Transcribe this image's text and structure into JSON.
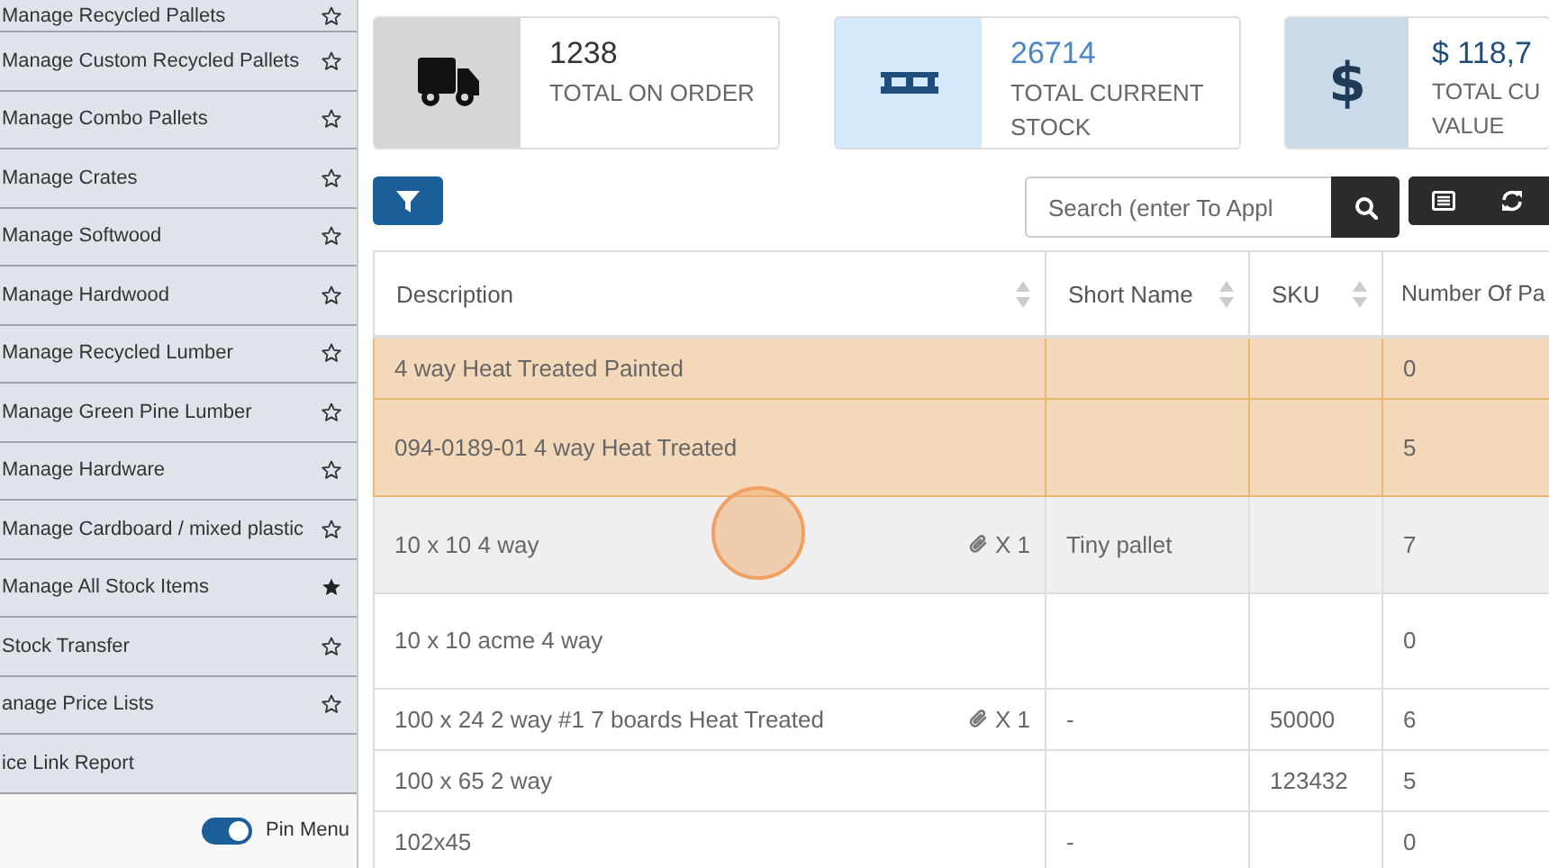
{
  "sidebar": {
    "items": [
      {
        "kind": "favorite",
        "label": "Manage Recycled Pallets",
        "starred": false
      },
      {
        "kind": "favorite",
        "label": "Manage Custom Recycled Pallets",
        "starred": false
      },
      {
        "kind": "favorite",
        "label": "Manage Combo Pallets",
        "starred": false
      },
      {
        "kind": "favorite",
        "label": "Manage Crates",
        "starred": false
      },
      {
        "kind": "favorite",
        "label": "Manage Softwood",
        "starred": false
      },
      {
        "kind": "favorite",
        "label": "Manage Hardwood",
        "starred": false
      },
      {
        "kind": "favorite",
        "label": "Manage Recycled Lumber",
        "starred": false
      },
      {
        "kind": "favorite",
        "label": "Manage Green Pine Lumber",
        "starred": false
      },
      {
        "kind": "favorite",
        "label": "Manage Hardware",
        "starred": false
      },
      {
        "kind": "favorite",
        "label": "Manage Cardboard / mixed plastic",
        "starred": false
      },
      {
        "kind": "favorite",
        "label": "Manage All Stock Items",
        "starred": true
      },
      {
        "kind": "favorite",
        "label": "Stock Transfer",
        "starred": false
      },
      {
        "kind": "favorite",
        "label": "anage Price Lists",
        "starred": false
      },
      {
        "kind": "plain",
        "label": "ice Link Report"
      }
    ],
    "pin_menu": {
      "label": "Pin Menu",
      "on": true
    }
  },
  "stats": [
    {
      "kind": "truck",
      "value": "1238",
      "label": "TOTAL ON ORDER"
    },
    {
      "kind": "pallet",
      "value": "26714",
      "label": "TOTAL CURRENT STOCK"
    },
    {
      "kind": "dollar",
      "icon_text": "$",
      "value": "$ 118,7",
      "label": "TOTAL CU VALUE"
    }
  ],
  "toolbar": {
    "search": {
      "placeholder": "Search (enter To Appl"
    }
  },
  "table": {
    "columns": [
      {
        "label": "Description",
        "sortable": true
      },
      {
        "label": "Short Name",
        "sortable": true
      },
      {
        "label": "SKU",
        "sortable": true
      },
      {
        "label": "Number Of Pa"
      }
    ],
    "rows": [
      {
        "highlighted": true,
        "hovered": false,
        "description": "4 way Heat Treated Painted",
        "number": "0"
      },
      {
        "highlighted": true,
        "hovered": false,
        "description": "094-0189-01 4 way Heat Treated",
        "number": "5"
      },
      {
        "highlighted": false,
        "hovered": true,
        "description": "10 x 10 4 way",
        "attachment": "X 1",
        "short_name": "Tiny pallet",
        "number": "7"
      },
      {
        "highlighted": false,
        "hovered": false,
        "description": "10 x 10 acme 4 way",
        "number": "0"
      },
      {
        "highlighted": false,
        "hovered": false,
        "description": "100 x 24 2 way #1 7 boards Heat Treated",
        "attachment": "X 1",
        "short_name": "-",
        "sku": "50000",
        "number": "6"
      },
      {
        "highlighted": false,
        "hovered": false,
        "description": "100 x 65 2 way",
        "sku": "123432",
        "number": "5"
      },
      {
        "highlighted": false,
        "hovered": false,
        "description": "102x45",
        "short_name": "-",
        "number": "0"
      }
    ]
  }
}
